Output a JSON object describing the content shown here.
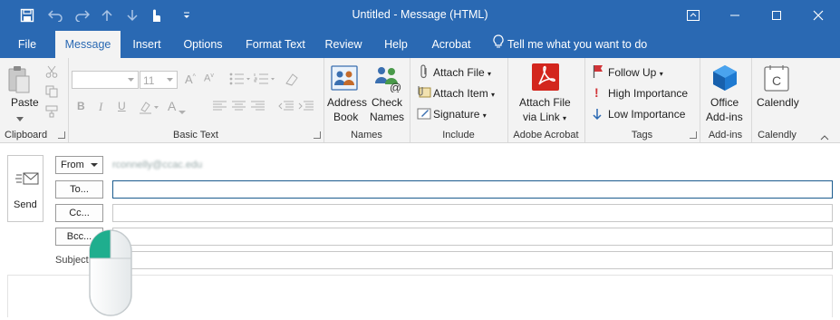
{
  "title_bar": {
    "title": "Untitled  -  Message (HTML)"
  },
  "tabs": [
    "File",
    "Message",
    "Insert",
    "Options",
    "Format Text",
    "Review",
    "Help",
    "Acrobat"
  ],
  "tell_me": "Tell me what you want to do",
  "clipboard": {
    "paste": "Paste",
    "label": "Clipboard"
  },
  "basic_text": {
    "font_size": "11",
    "label": "Basic Text"
  },
  "names": {
    "address": "Address",
    "book": "Book",
    "check": "Check",
    "names": "Names",
    "label": "Names"
  },
  "include": {
    "attach_file": "Attach File",
    "attach_item": "Attach Item",
    "signature": "Signature",
    "label": "Include"
  },
  "acrobat": {
    "line1": "Attach File",
    "line2": "via Link",
    "label": "Adobe Acrobat"
  },
  "tags": {
    "follow_up": "Follow Up",
    "high": "High Importance",
    "low": "Low Importance",
    "label": "Tags"
  },
  "addins": {
    "line1": "Office",
    "line2": "Add-ins",
    "label": "Add-ins"
  },
  "calendly": {
    "name": "Calendly",
    "label": "Calendly"
  },
  "compose": {
    "send": "Send",
    "from": "From",
    "from_value": "rconnelly@ccac.edu",
    "to": "To...",
    "cc": "Cc...",
    "bcc": "Bcc...",
    "subject": "Subject"
  },
  "colors": {
    "title_bar": "#2a69b3",
    "ribbon": "#f3f3f3",
    "acrobat_red": "#d3261d",
    "addins_blue": "#1f7ad1",
    "mouse_teal": "#1fae8e"
  }
}
